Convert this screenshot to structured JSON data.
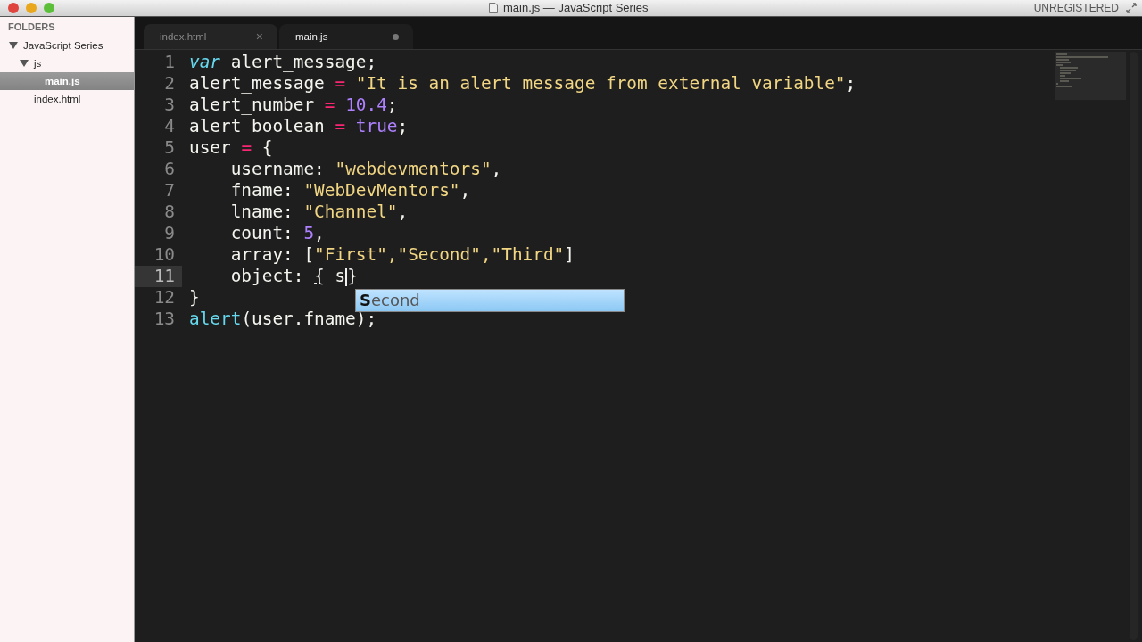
{
  "window": {
    "title": "main.js — JavaScript Series",
    "badge": "UNREGISTERED"
  },
  "sidebar": {
    "heading": "FOLDERS",
    "tree": [
      {
        "label": "JavaScript Series",
        "expanded": true,
        "selected": false,
        "children": [
          {
            "label": "js",
            "expanded": true,
            "selected": false,
            "children": [
              {
                "label": "main.js",
                "selected": true
              }
            ]
          },
          {
            "label": "index.html",
            "selected": false
          }
        ]
      }
    ]
  },
  "tabs": [
    {
      "label": "index.html",
      "selected": false,
      "modified": false,
      "close": "×"
    },
    {
      "label": "main.js",
      "selected": true,
      "modified": true
    }
  ],
  "editor": {
    "lines": [
      {
        "number": "1",
        "current": false,
        "tokens": [
          {
            "kind": "keyword",
            "text": "var"
          },
          {
            "kind": "plain",
            "text": " alert_message;"
          }
        ]
      },
      {
        "number": "2",
        "current": false,
        "tokens": [
          {
            "kind": "plain",
            "text": "alert_message "
          },
          {
            "kind": "operator",
            "text": "= "
          },
          {
            "kind": "string",
            "text": "\"It is an alert message from external variable\""
          },
          {
            "kind": "plain",
            "text": ";"
          }
        ]
      },
      {
        "number": "3",
        "current": false,
        "tokens": [
          {
            "kind": "plain",
            "text": "alert_number "
          },
          {
            "kind": "operator",
            "text": "= "
          },
          {
            "kind": "number",
            "text": "10.4"
          },
          {
            "kind": "plain",
            "text": ";"
          }
        ]
      },
      {
        "number": "4",
        "current": false,
        "tokens": [
          {
            "kind": "plain",
            "text": "alert_boolean "
          },
          {
            "kind": "operator",
            "text": "= "
          },
          {
            "kind": "number",
            "text": "true"
          },
          {
            "kind": "plain",
            "text": ";"
          }
        ]
      },
      {
        "number": "5",
        "current": false,
        "tokens": [
          {
            "kind": "plain",
            "text": "user "
          },
          {
            "kind": "operator",
            "text": "="
          },
          {
            "kind": "plain",
            "text": " {"
          }
        ]
      },
      {
        "number": "6",
        "current": false,
        "tokens": [
          {
            "kind": "plain",
            "text": "    username: "
          },
          {
            "kind": "string",
            "text": "\"webdevmentors\""
          },
          {
            "kind": "plain",
            "text": ","
          }
        ]
      },
      {
        "number": "7",
        "current": false,
        "tokens": [
          {
            "kind": "plain",
            "text": "    fname: "
          },
          {
            "kind": "string",
            "text": "\"WebDevMentors\""
          },
          {
            "kind": "plain",
            "text": ","
          }
        ]
      },
      {
        "number": "8",
        "current": false,
        "tokens": [
          {
            "kind": "plain",
            "text": "    lname: "
          },
          {
            "kind": "string",
            "text": "\"Channel\""
          },
          {
            "kind": "plain",
            "text": ","
          }
        ]
      },
      {
        "number": "9",
        "current": false,
        "tokens": [
          {
            "kind": "plain",
            "text": "    count: "
          },
          {
            "kind": "number",
            "text": "5"
          },
          {
            "kind": "plain",
            "text": ","
          }
        ]
      },
      {
        "number": "10",
        "current": false,
        "tokens": [
          {
            "kind": "plain",
            "text": "    array: ["
          },
          {
            "kind": "string",
            "text": "\"First\",\"Second\",\"Third\""
          },
          {
            "kind": "plain",
            "text": "]"
          }
        ]
      },
      {
        "number": "11",
        "current": true,
        "tokens": [
          {
            "kind": "plain",
            "text": "    object: "
          },
          {
            "kind": "bracket",
            "text": "{"
          },
          {
            "kind": "plain",
            "text": " s"
          },
          {
            "kind": "caret"
          },
          {
            "kind": "plain",
            "text": "}"
          }
        ]
      },
      {
        "number": "12",
        "current": false,
        "tokens": [
          {
            "kind": "plain",
            "text": "}"
          }
        ]
      },
      {
        "number": "13",
        "current": false,
        "tokens": [
          {
            "kind": "function",
            "text": "alert"
          },
          {
            "kind": "plain",
            "text": "(user.fname);"
          }
        ]
      }
    ],
    "autocomplete": {
      "items": [
        {
          "label": "**S**econd",
          "selected": true
        }
      ]
    }
  }
}
